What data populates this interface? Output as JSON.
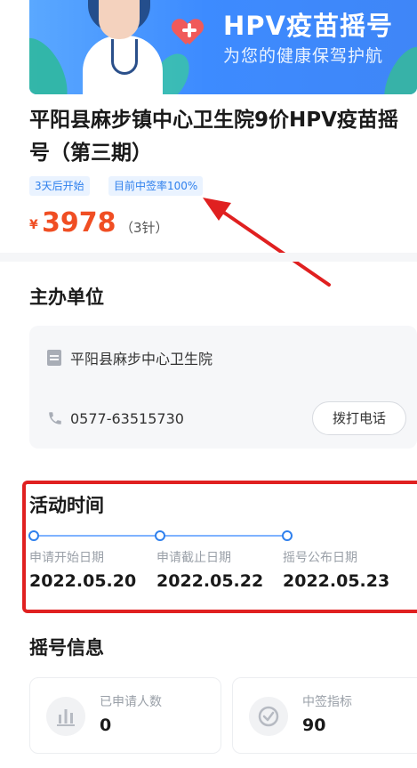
{
  "banner": {
    "title": "HPV疫苗摇号",
    "subtitle": "为您的健康保驾护航"
  },
  "product": {
    "title": "平阳县麻步镇中心卫生院9价HPV疫苗摇号（第三期）",
    "tags": [
      "3天后开始",
      "目前中签率100%"
    ],
    "currency": "¥",
    "price": "3978",
    "dose": "（3针）"
  },
  "organizer": {
    "section_title": "主办单位",
    "name": "平阳县麻步中心卫生院",
    "phone": "0577-63515730",
    "call_button": "拨打电话",
    "icons": [
      "document-icon",
      "phone-icon"
    ]
  },
  "activity_time": {
    "section_title": "活动时间",
    "items": [
      {
        "label": "申请开始日期",
        "date": "2022.05.20"
      },
      {
        "label": "申请截止日期",
        "date": "2022.05.22"
      },
      {
        "label": "摇号公布日期",
        "date": "2022.05.23"
      }
    ]
  },
  "lottery_info": {
    "section_title": "摇号信息",
    "cards": [
      {
        "label": "已申请人数",
        "value": "0",
        "icon": "bar-chart-icon"
      },
      {
        "label": "中签指标",
        "value": "90",
        "icon": "check-circle-icon"
      }
    ]
  },
  "colors": {
    "accent": "#2f80ed",
    "price": "#f04e23",
    "annotation": "#e02020"
  }
}
